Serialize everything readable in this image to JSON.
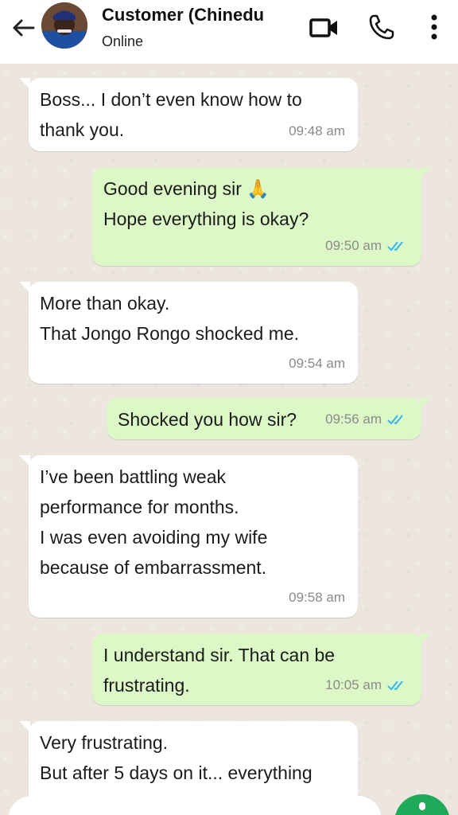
{
  "header": {
    "title": "Customer (Chinedu",
    "status": "Online",
    "icons": [
      "back-arrow-icon",
      "video-call-icon",
      "phone-icon",
      "more-vertical-icon"
    ]
  },
  "messages": [
    {
      "direction": "in",
      "lines": [
        "Boss... I don’t even know how to",
        "thank you."
      ],
      "time": "09:48 am"
    },
    {
      "direction": "out",
      "lines": [
        "Good evening sir 🙏",
        "Hope everything is okay?"
      ],
      "time": "09:50 am",
      "read": true
    },
    {
      "direction": "in",
      "lines": [
        "More than okay.",
        "That Jongo Rongo shocked me."
      ],
      "time": "09:54 am"
    },
    {
      "direction": "out",
      "lines": [
        "Shocked you how sir?"
      ],
      "time": "09:56 am",
      "read": true
    },
    {
      "direction": "in",
      "lines": [
        "I’ve been battling weak",
        "performance for months.",
        "I was even avoiding my wife",
        "because of embarrassment."
      ],
      "time": "09:58 am"
    },
    {
      "direction": "out",
      "lines": [
        "I understand sir. That can be",
        "frustrating."
      ],
      "time": "10:05 am",
      "read": true
    },
    {
      "direction": "in",
      "lines": [
        "Very frustrating.",
        "But after 5 days on it... everything"
      ],
      "time": ""
    }
  ],
  "colors": {
    "incoming_bubble": "#ffffff",
    "outgoing_bubble": "#dcf8c6",
    "read_ticks": "#34b7f1",
    "send_button": "#1faa59"
  }
}
